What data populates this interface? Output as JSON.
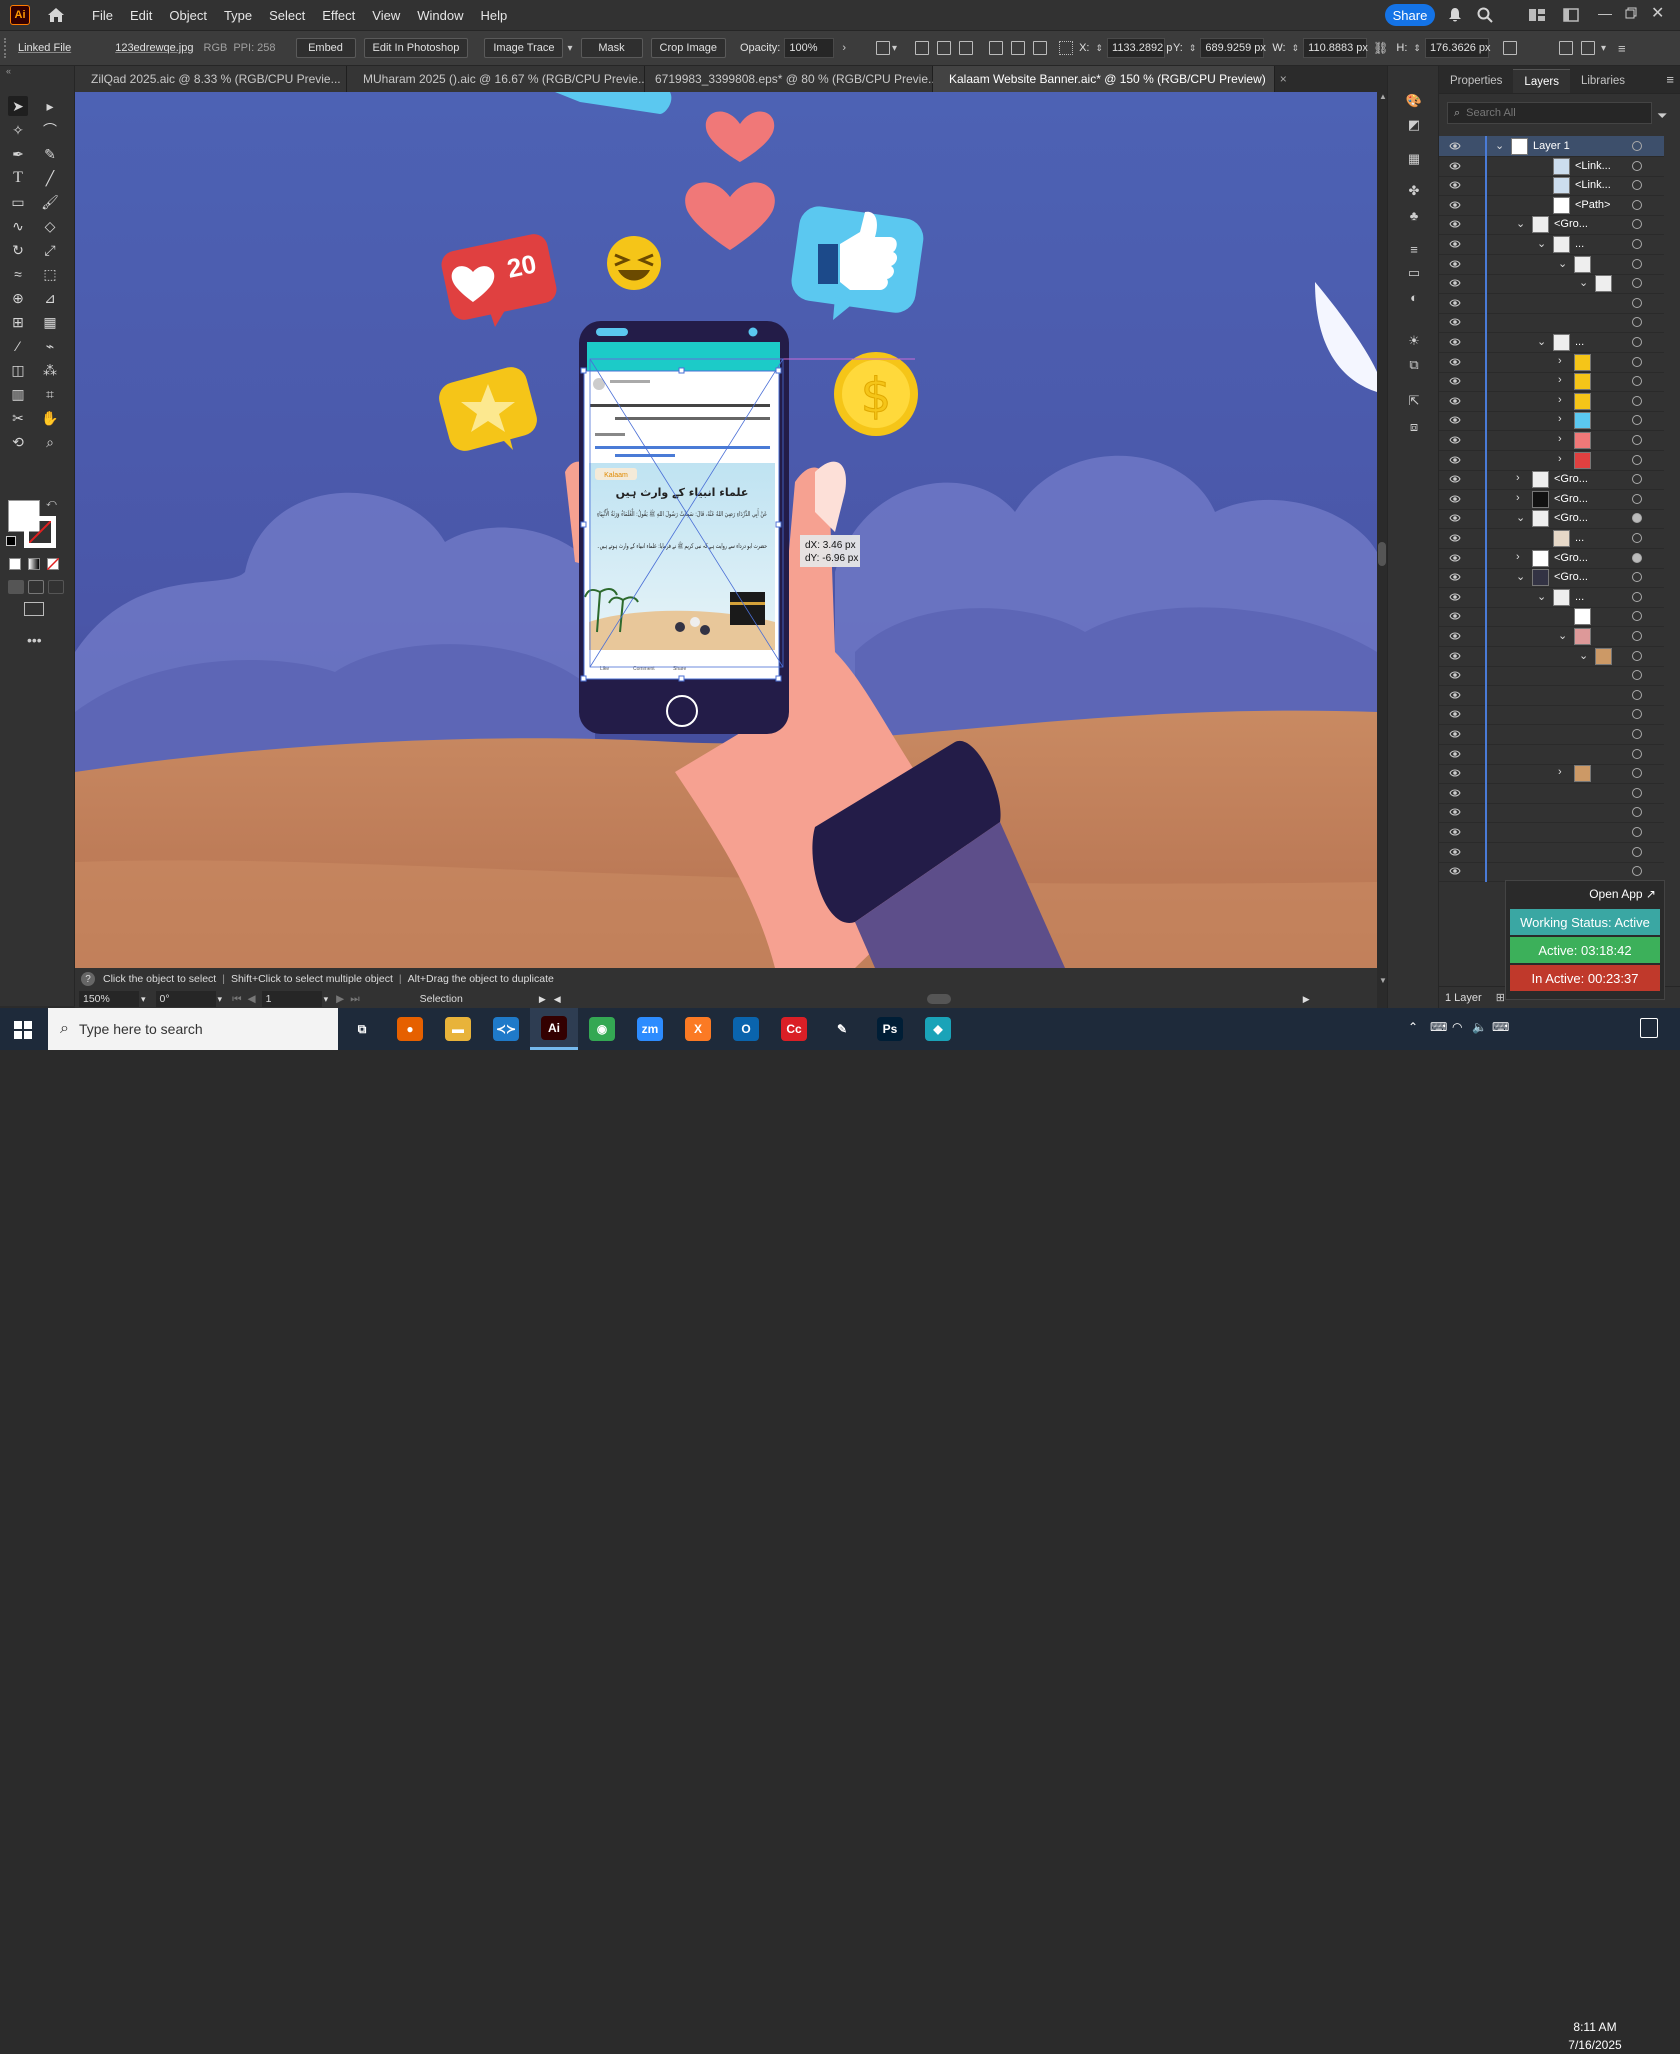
{
  "menu": {
    "logo": "Ai",
    "items": [
      "File",
      "Edit",
      "Object",
      "Type",
      "Select",
      "Effect",
      "View",
      "Window",
      "Help"
    ],
    "share": "Share"
  },
  "control": {
    "linked_file": "Linked File",
    "filename": "123edrewqe.jpg",
    "color_mode": "RGB",
    "ppi_label": "PPI:",
    "ppi": "258",
    "embed": "Embed",
    "edit_photoshop": "Edit In Photoshop",
    "image_trace": "Image Trace",
    "mask": "Mask",
    "crop_image": "Crop Image",
    "opacity_label": "Opacity:",
    "opacity": "100%",
    "x_label": "X:",
    "x": "1133.2892 p",
    "y_label": "Y:",
    "y": "689.9259 px",
    "w_label": "W:",
    "w": "110.8883 px",
    "h_label": "H:",
    "h": "176.3626 px"
  },
  "tabs": [
    {
      "label": "ZilQad 2025.aic @ 8.33 % (RGB/CPU Previe...",
      "close": "×"
    },
    {
      "label": "MUharam 2025 ().aic @ 16.67 % (RGB/CPU Previe...",
      "close": "×"
    },
    {
      "label": "6719983_3399808.eps* @ 80 % (RGB/CPU Previe...",
      "close": "×"
    },
    {
      "label": "Kalaam Website Banner.aic* @ 150 % (RGB/CPU Preview)",
      "close": "×"
    }
  ],
  "canvas": {
    "badge_count": "20",
    "delta_x": "dX: 3.46 px",
    "delta_y": "dY: -6.96 px",
    "post": {
      "brand": "Kalaam",
      "headline": "علماء انبیاء کے وارث ہیں",
      "arabic": "عَنْ أَبِي الدَّرْدَاءِ رَضِيَ اللهُ عَنْهُ، قَالَ: سَمِعْتُ رَسُولَ اللهِ ﷺ يَقُولُ: الْعُلَمَاءُ وَرَثَةُ الْأَنْبِيَاءِ",
      "urdu": "حضرت ابو درداء سے روایت ہے کہ نبی کریم ﷺ نے فرمایا: علماء انبیاء کے وارث ہوتے ہیں۔",
      "actions": [
        "Like",
        "Comment",
        "Share"
      ]
    }
  },
  "status": {
    "hint1": "Click the object to select",
    "hint2": "Shift+Click to select multiple object",
    "hint3": "Alt+Drag the object to duplicate",
    "zoom": "150%",
    "rotate": "0°",
    "artboard": "1",
    "tool": "Selection"
  },
  "panel": {
    "tabs": [
      "Properties",
      "Layers",
      "Libraries"
    ],
    "search_placeholder": "Search All",
    "footer": "1 Layer",
    "layers": [
      {
        "indent": 0,
        "tw": "v",
        "name": "Layer 1",
        "sel": true,
        "thumb": "#fff"
      },
      {
        "indent": 2,
        "tw": "",
        "name": "<Link...",
        "thumb": "#cde"
      },
      {
        "indent": 2,
        "tw": "",
        "name": "<Link...",
        "thumb": "#cde"
      },
      {
        "indent": 2,
        "tw": "",
        "name": "<Path>",
        "thumb": "#fff"
      },
      {
        "indent": 1,
        "tw": "v",
        "name": "<Gro...",
        "thumb": "#eee"
      },
      {
        "indent": 2,
        "tw": "v",
        "name": "...",
        "thumb": "#eee"
      },
      {
        "indent": 3,
        "tw": "v",
        "name": "",
        "thumb": "#eee"
      },
      {
        "indent": 4,
        "tw": "v",
        "name": "",
        "thumb": "#eee"
      },
      {
        "indent": 4,
        "tw": "",
        "name": "",
        "thumb": ""
      },
      {
        "indent": 4,
        "tw": "",
        "name": "",
        "thumb": ""
      },
      {
        "indent": 2,
        "tw": "v",
        "name": "...",
        "thumb": "#eee"
      },
      {
        "indent": 3,
        "tw": ">",
        "name": "",
        "thumb": "#f5c518"
      },
      {
        "indent": 3,
        "tw": ">",
        "name": "",
        "thumb": "#f5c518"
      },
      {
        "indent": 3,
        "tw": ">",
        "name": "",
        "thumb": "#f5c518"
      },
      {
        "indent": 3,
        "tw": ">",
        "name": "",
        "thumb": "#5bc8f0"
      },
      {
        "indent": 3,
        "tw": ">",
        "name": "",
        "thumb": "#f07878"
      },
      {
        "indent": 3,
        "tw": ">",
        "name": "",
        "thumb": "#e04040"
      },
      {
        "indent": 1,
        "tw": ">",
        "name": "<Gro...",
        "thumb": "#eee"
      },
      {
        "indent": 1,
        "tw": ">",
        "name": "<Gro...",
        "thumb": "#111"
      },
      {
        "indent": 1,
        "tw": "v",
        "name": "<Gro...",
        "thumb": "#eee"
      },
      {
        "indent": 2,
        "tw": "",
        "name": "...",
        "thumb": "#e6d8c8"
      },
      {
        "indent": 1,
        "tw": ">",
        "name": "<Gro...",
        "thumb": "#fff"
      },
      {
        "indent": 1,
        "tw": "v",
        "name": "<Gro...",
        "thumb": "#334"
      },
      {
        "indent": 2,
        "tw": "v",
        "name": "...",
        "thumb": "#eee"
      },
      {
        "indent": 3,
        "tw": "",
        "name": "",
        "thumb": "#fff"
      },
      {
        "indent": 3,
        "tw": "v",
        "name": "",
        "thumb": "#d99"
      },
      {
        "indent": 4,
        "tw": "v",
        "name": "",
        "thumb": "#c96"
      },
      {
        "indent": 4,
        "tw": "",
        "name": "",
        "thumb": ""
      },
      {
        "indent": 4,
        "tw": "",
        "name": "",
        "thumb": ""
      },
      {
        "indent": 4,
        "tw": "",
        "name": "",
        "thumb": ""
      },
      {
        "indent": 4,
        "tw": "",
        "name": "",
        "thumb": ""
      },
      {
        "indent": 4,
        "tw": "",
        "name": "",
        "thumb": ""
      },
      {
        "indent": 3,
        "tw": ">",
        "name": "",
        "thumb": "#c96"
      },
      {
        "indent": 4,
        "tw": "",
        "name": "",
        "thumb": ""
      },
      {
        "indent": 4,
        "tw": "",
        "name": "",
        "thumb": ""
      },
      {
        "indent": 4,
        "tw": "",
        "name": "",
        "thumb": ""
      },
      {
        "indent": 4,
        "tw": "",
        "name": "",
        "thumb": ""
      },
      {
        "indent": 4,
        "tw": "",
        "name": "",
        "thumb": ""
      }
    ]
  },
  "tracker": {
    "open_app": "Open App ↗",
    "working": "Working Status: Active",
    "active": "Active: 03:18:42",
    "inactive": "In Active: 00:23:37",
    "colors": {
      "working": "#3aa7a3",
      "active": "#3cb05a",
      "inactive": "#c0392b"
    }
  },
  "taskbar": {
    "search_placeholder": "Type here to search",
    "time": "8:11 AM",
    "date": "7/16/2025",
    "apps": [
      {
        "name": "task-view",
        "label": "⧉",
        "color": "transparent"
      },
      {
        "name": "firefox",
        "label": "●",
        "color": "#e66000"
      },
      {
        "name": "file-explorer",
        "label": "▬",
        "color": "#e8b33a"
      },
      {
        "name": "vscode",
        "label": "≺≻",
        "color": "#1f7ac9"
      },
      {
        "name": "illustrator",
        "label": "Ai",
        "color": "#330000",
        "active": true
      },
      {
        "name": "chrome",
        "label": "◉",
        "color": "#34a853"
      },
      {
        "name": "zoom",
        "label": "zm",
        "color": "#2d8cff"
      },
      {
        "name": "xampp",
        "label": "X",
        "color": "#fb7a24"
      },
      {
        "name": "outlook",
        "label": "O",
        "color": "#0a64ad"
      },
      {
        "name": "creative-cloud",
        "label": "Cc",
        "color": "#da1f26"
      },
      {
        "name": "inkscape",
        "label": "✎",
        "color": "transparent"
      },
      {
        "name": "photoshop",
        "label": "Ps",
        "color": "#001e36"
      },
      {
        "name": "app-cube",
        "label": "◆",
        "color": "#1aa3b8"
      }
    ]
  }
}
